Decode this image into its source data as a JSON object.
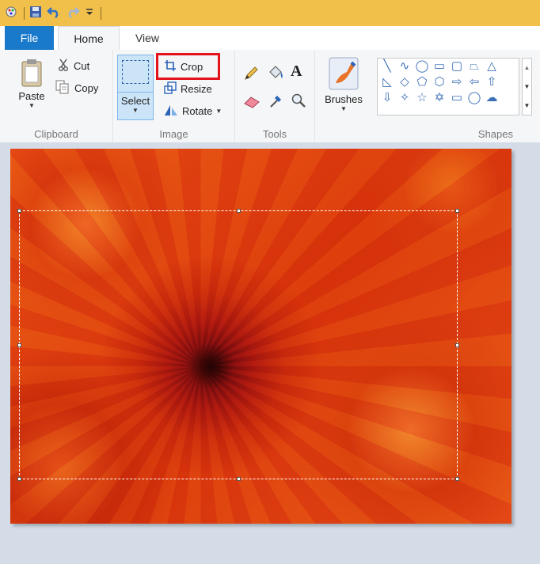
{
  "window": {
    "icons": [
      "paint-icon",
      "save-icon",
      "undo-icon",
      "redo-icon",
      "customize-icon"
    ]
  },
  "tabs": [
    {
      "label": "File"
    },
    {
      "label": "Home"
    },
    {
      "label": "View"
    }
  ],
  "clipboard": {
    "paste_label": "Paste",
    "cut_label": "Cut",
    "copy_label": "Copy",
    "group_label": "Clipboard"
  },
  "image": {
    "select_label": "Select",
    "crop_label": "Crop",
    "resize_label": "Resize",
    "rotate_label": "Rotate",
    "group_label": "Image"
  },
  "tools": {
    "group_label": "Tools",
    "items": [
      "pencil-icon",
      "fill-icon",
      "text-icon",
      "eraser-icon",
      "color-picker-icon",
      "magnifier-icon"
    ]
  },
  "brushes": {
    "label": "Brushes"
  },
  "shapes": {
    "group_label": "Shapes",
    "items": [
      "line",
      "curve",
      "oval",
      "rectangle",
      "rounded-rectangle",
      "polygon",
      "triangle",
      "right-triangle",
      "diamond",
      "pentagon",
      "hexagon",
      "right-arrow",
      "left-arrow",
      "up-arrow",
      "down-arrow",
      "four-point-star",
      "five-point-star",
      "six-point-star",
      "rounded-callout",
      "oval-callout",
      "cloud-callout"
    ]
  },
  "colors": {
    "accent": "#1979ca",
    "qat": "#f0c04a",
    "highlight": "#e3121b",
    "workspace": "#d4dce8"
  }
}
